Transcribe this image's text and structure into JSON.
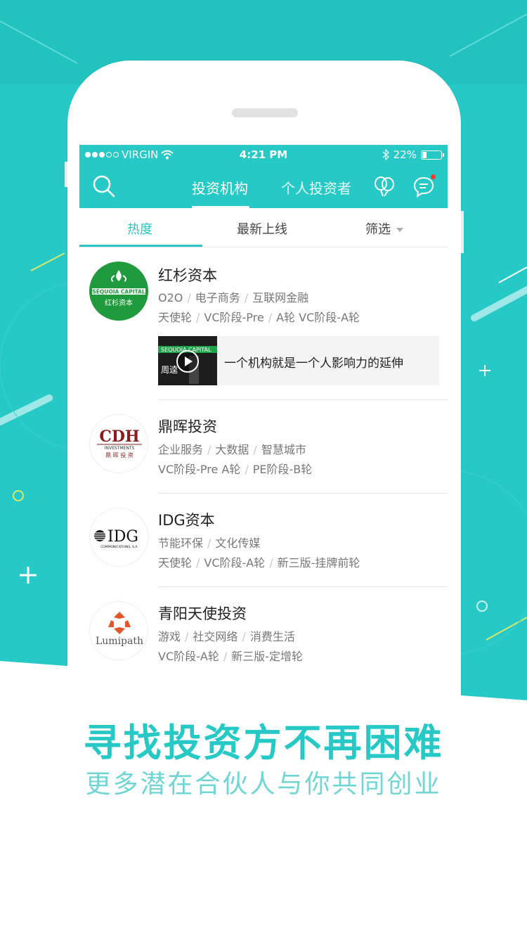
{
  "colors": {
    "accent": "#27c9c6",
    "badge": "#ff3b30"
  },
  "status_bar": {
    "carrier": "VIRGIN",
    "time": "4:21 PM",
    "battery": "22%",
    "battery_level": 0.22
  },
  "nav": {
    "tabs": [
      {
        "label": "投资机构"
      },
      {
        "label": "个人投资者"
      }
    ],
    "icons": [
      "search-icon",
      "balloons-icon",
      "message-icon"
    ]
  },
  "subtabs": {
    "items": [
      {
        "label": "热度"
      },
      {
        "label": "最新上线"
      },
      {
        "label": "筛选"
      }
    ]
  },
  "investors": [
    {
      "name": "红杉资本",
      "logo_text_en": "SEQUOIA CAPITAL",
      "logo_text_cn": "红杉资本",
      "tags": [
        "O2O",
        "电子商务",
        "互联网金融"
      ],
      "rounds": [
        "天使轮",
        "VC阶段-Pre",
        "A轮 VC阶段-A轮"
      ],
      "video": {
        "caption": "一个机构就是一个人影响力的延伸",
        "thumb_text": "周逵"
      }
    },
    {
      "name": "鼎晖投资",
      "logo_text_en": "CDH",
      "logo_sub": "INVESTMENTS",
      "logo_cn": "鼎 晖 投 资",
      "tags": [
        "企业服务",
        "大数据",
        "智慧城市"
      ],
      "rounds": [
        "VC阶段-Pre A轮",
        "PE阶段-B轮"
      ]
    },
    {
      "name": "IDG资本",
      "logo_text_en": "IDG",
      "logo_sub": "COMMUNICATIONS, S.A.",
      "tags": [
        "节能环保",
        "文化传媒"
      ],
      "rounds": [
        "天使轮",
        "VC阶段-A轮",
        "新三版-挂牌前轮"
      ]
    },
    {
      "name": "青阳天使投资",
      "logo_text_en": "Lumipath",
      "tags": [
        "游戏",
        "社交网络",
        "消费生活"
      ],
      "rounds": [
        "VC阶段-A轮",
        "新三版-定增轮"
      ]
    }
  ],
  "promo": {
    "headline": "寻找投资方不再困难",
    "subline": "更多潜在合伙人与你共同创业"
  }
}
